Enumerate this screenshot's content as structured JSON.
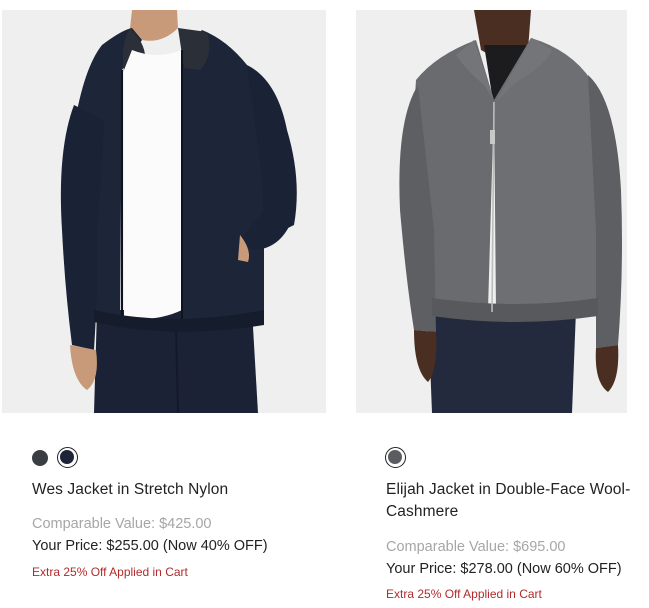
{
  "products": [
    {
      "image_alt": "Model wearing a navy hooded zip jacket over a white tee",
      "swatches": [
        {
          "color": "#3a3d42",
          "selected": false
        },
        {
          "color": "#1f2538",
          "selected": true
        }
      ],
      "name": "Wes Jacket in Stretch Nylon",
      "comparable": "Comparable Value: $425.00",
      "price": "Your Price: $255.00 (Now 40% OFF)",
      "promo": "Extra 25% Off Applied in Cart"
    },
    {
      "image_alt": "Model wearing a grey wool zip jacket with pointed collar",
      "swatches": [
        {
          "color": "#5a5c61",
          "selected": true
        }
      ],
      "name": "Elijah Jacket in Double-Face Wool-Cashmere",
      "comparable": "Comparable Value: $695.00",
      "price": "Your Price: $278.00 (Now 60% OFF)",
      "promo": "Extra 25% Off Applied in Cart"
    }
  ],
  "colors": {
    "muted_text": "#a6a6a6",
    "promo_red": "#b32a2a",
    "image_background": "#efefef"
  }
}
